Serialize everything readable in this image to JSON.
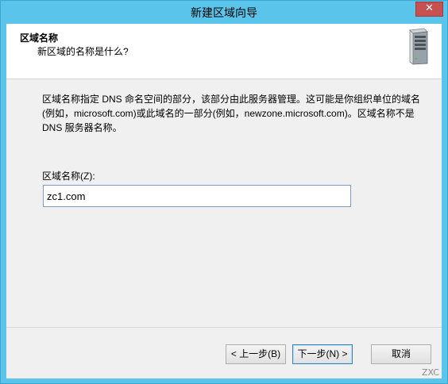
{
  "window": {
    "title": "新建区域向导",
    "close_label": "✕"
  },
  "header": {
    "title": "区域名称",
    "subtitle": "新区域的名称是什么?"
  },
  "body": {
    "description": "区域名称指定 DNS 命名空间的部分，该部分由此服务器管理。这可能是你组织单位的域名(例如，microsoft.com)或此域名的一部分(例如，newzone.microsoft.com)。区域名称不是 DNS 服务器名称。",
    "zone_name_label": "区域名称(Z):",
    "zone_name_value": "zc1.com"
  },
  "buttons": {
    "back": "< 上一步(B)",
    "next": "下一步(N) >",
    "cancel": "取消"
  },
  "watermark": "ZXC",
  "icons": {
    "header_icon": "server-icon",
    "close": "close-icon"
  }
}
